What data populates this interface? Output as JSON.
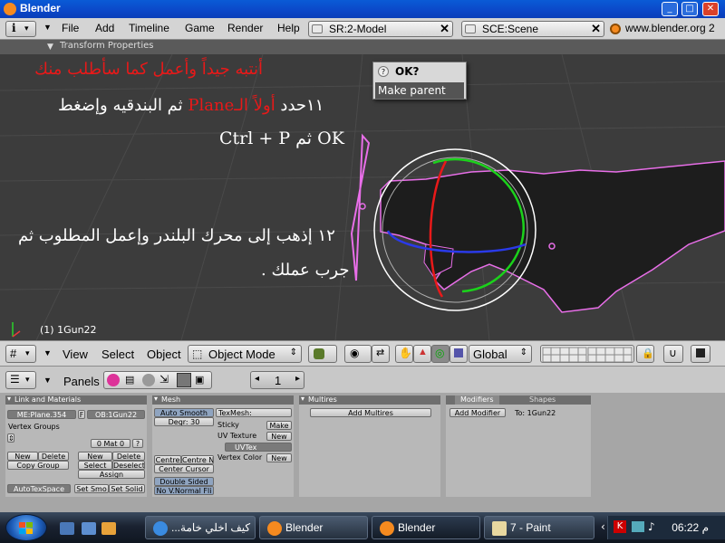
{
  "window": {
    "title": "Blender"
  },
  "menubar": {
    "items": [
      "File",
      "Add",
      "Timeline",
      "Game",
      "Render",
      "Help"
    ],
    "screen_field": "SR:2-Model",
    "scene_field": "SCE:Scene",
    "website": "www.blender.org 2"
  },
  "viewport": {
    "panel_label": "Transform Properties",
    "arabic_line1": "أنتبه جيداً وأعمل كما سأطلب منك",
    "arabic_line2_num": "١١حدد ",
    "arabic_line2_red": "أولاً الـPlane",
    "arabic_line2_rest": " ثم البندقيه وإضغط",
    "arabic_line3": "OK ثم Ctrl + P",
    "arabic_line4": "١٢ إذهب إلى محرك البلندر وإعمل المطلوب ثم",
    "arabic_line5": "جرب عملك .",
    "popup_title": "OK?",
    "popup_item": "Make parent",
    "object_name": "(1) 1Gun22"
  },
  "toolbar": {
    "view": "View",
    "select": "Select",
    "object": "Object",
    "mode": "Object Mode",
    "orientation": "Global"
  },
  "buttons": {
    "panels_label": "Panels",
    "frame": "1",
    "link": {
      "title": "Link and Materials",
      "me": "ME:Plane.354",
      "f": "F",
      "ob": "OB:1Gun22",
      "vgroups": "Vertex Groups",
      "mat": "0 Mat 0",
      "q": "?",
      "new": "New",
      "delete": "Delete",
      "copy_group": "Copy Group",
      "new2": "New",
      "delete2": "Delete",
      "select": "Select",
      "deselect": "Deselect",
      "assign": "Assign",
      "autotex": "AutoTexSpace",
      "set_smo": "Set Smo",
      "set_solid": "Set Solid"
    },
    "mesh": {
      "title": "Mesh",
      "auto_smooth": "Auto Smooth",
      "degr": "Degr: 30",
      "texmesh": "TexMesh:",
      "sticky": "Sticky",
      "make": "Make",
      "uv_texture": "UV Texture",
      "new": "New",
      "uvtex": "UVTex",
      "vertex_color": "Vertex Color",
      "new2": "New",
      "centre": "Centre",
      "centre_new": "Centre Ne",
      "center_cursor": "Center Cursor",
      "double_sided": "Double Sided",
      "no_vnormal": "No V.Normal Fli"
    },
    "multires": {
      "title": "Multires",
      "add": "Add Multires"
    },
    "modifiers": {
      "tab1": "Modifiers",
      "tab2": "Shapes",
      "add": "Add Modifier",
      "to": "To: 1Gun22"
    }
  },
  "taskbar": {
    "tasks": [
      "...كيف اخلي خامة",
      "Blender",
      "Blender",
      "7 - Paint"
    ],
    "clock": "06:22 م"
  }
}
